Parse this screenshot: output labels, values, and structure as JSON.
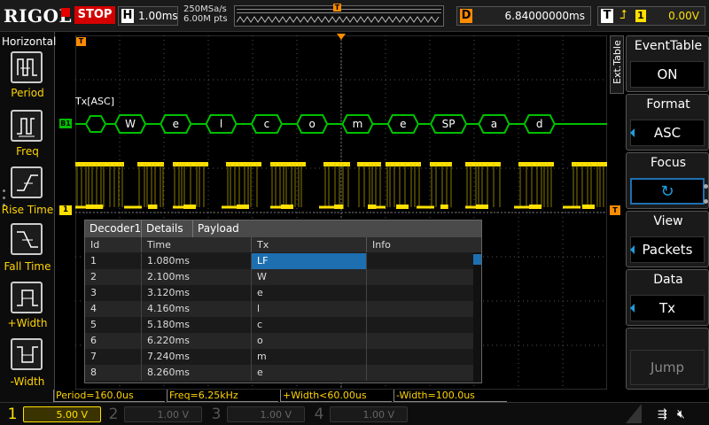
{
  "topbar": {
    "brand": "RIGOL",
    "run_state": "STOP",
    "horizontal": {
      "key": "H",
      "value": "1.00ms"
    },
    "sample": {
      "rate": "250MSa/s",
      "points": "6.00M pts"
    },
    "trigger_pos_marker": "T",
    "delay": {
      "key": "D",
      "value": "6.84000000ms"
    },
    "trigger": {
      "key": "T",
      "edge": "⮥",
      "source": "1",
      "level": "0.00V"
    }
  },
  "left_panel": {
    "title": "Horizontal",
    "items": [
      {
        "label": "Period",
        "icon": "period-icon"
      },
      {
        "label": "Freq",
        "icon": "freq-icon"
      },
      {
        "label": "Rise Time",
        "icon": "rise-time-icon"
      },
      {
        "label": "Fall Time",
        "icon": "fall-time-icon"
      },
      {
        "label": "+Width",
        "icon": "pos-width-icon"
      },
      {
        "label": "-Width",
        "icon": "neg-width-icon"
      }
    ]
  },
  "waveform": {
    "decoder_label": "Tx[ASC]",
    "bus_marker": "B1",
    "channel_marker": "1",
    "trigger_level_marker": "T",
    "trigger_time_marker": "T",
    "packets": [
      "W",
      "e",
      "l",
      "c",
      "o",
      "m",
      "e",
      "SP",
      "a",
      "d"
    ]
  },
  "event_table": {
    "tabs": [
      "Decoder1",
      "Details",
      "Payload"
    ],
    "columns": [
      "Id",
      "Time",
      "Tx",
      "Info"
    ],
    "rows": [
      {
        "id": "1",
        "time": "1.080ms",
        "tx": "LF",
        "info": ""
      },
      {
        "id": "2",
        "time": "2.100ms",
        "tx": "W",
        "info": ""
      },
      {
        "id": "3",
        "time": "3.120ms",
        "tx": "e",
        "info": ""
      },
      {
        "id": "4",
        "time": "4.160ms",
        "tx": "l",
        "info": ""
      },
      {
        "id": "5",
        "time": "5.180ms",
        "tx": "c",
        "info": ""
      },
      {
        "id": "6",
        "time": "6.220ms",
        "tx": "o",
        "info": ""
      },
      {
        "id": "7",
        "time": "7.240ms",
        "tx": "m",
        "info": ""
      },
      {
        "id": "8",
        "time": "8.260ms",
        "tx": "e",
        "info": ""
      }
    ],
    "selected_row": 0
  },
  "right_panel": {
    "ext_tab": "Ext.Table",
    "items": [
      {
        "title": "EventTable",
        "value": "ON"
      },
      {
        "title": "Format",
        "value": "ASC"
      },
      {
        "title": "Focus",
        "value": "↻"
      },
      {
        "title": "View",
        "value": "Packets"
      },
      {
        "title": "Data",
        "value": "Tx"
      },
      {
        "title": "",
        "value": "Jump"
      }
    ]
  },
  "measurements": [
    "Period=160.0us",
    "Freq=6.25kHz",
    "+Width<60.00us",
    "-Width=100.0us"
  ],
  "channels": [
    {
      "num": "1",
      "scale": "5.00 V",
      "state": "on"
    },
    {
      "num": "2",
      "scale": "1.00 V",
      "state": "off"
    },
    {
      "num": "3",
      "scale": "1.00 V",
      "state": "off"
    },
    {
      "num": "4",
      "scale": "1.00 V",
      "state": "off"
    }
  ],
  "status_icons": [
    "usb-icon",
    "sound-mute-icon"
  ],
  "colors": {
    "channel1": "#ffe000",
    "bus": "#00c000",
    "trigger": "#ff8c00",
    "stop": "#d40000",
    "selection": "#1e6fb0"
  }
}
